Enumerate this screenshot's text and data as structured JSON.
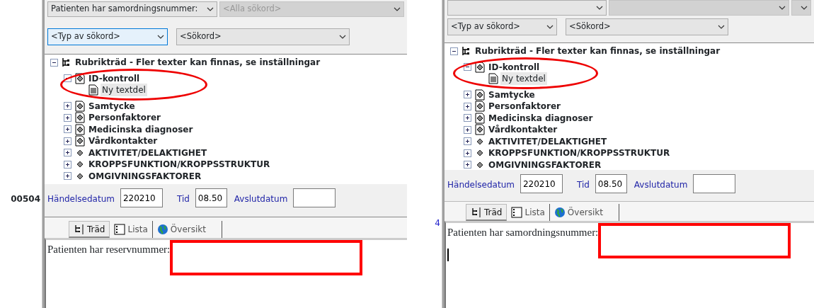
{
  "panels": [
    {
      "side_text": "00504",
      "top_combos": [
        {
          "text": "Patienten har samordningsnummer:",
          "disabled": false
        },
        {
          "text": "<Alla sökord>",
          "disabled": true
        }
      ],
      "search_type": {
        "text": "<Typ av sökord>",
        "focused": true
      },
      "keyword": {
        "text": "<Sökord>"
      },
      "tree": {
        "highlight_ellipse": true,
        "root": {
          "label": "Rubrikträd - Fler texter kan finnas, se inställningar",
          "kind": "root",
          "expanded": true,
          "children": [
            {
              "label": "ID-kontroll",
              "kind": "group",
              "expanded": true,
              "children": [
                {
                  "label": "Ny textdel",
                  "kind": "text",
                  "selected": true
                }
              ]
            },
            {
              "label": "Samtycke",
              "kind": "group",
              "expanded": false
            },
            {
              "label": "Personfaktorer",
              "kind": "group",
              "expanded": false
            },
            {
              "label": "Medicinska diagnoser",
              "kind": "group",
              "expanded": false
            },
            {
              "label": "Vårdkontakter",
              "kind": "group",
              "expanded": false
            },
            {
              "label": "AKTIVITET/DELAKTIGHET",
              "kind": "category",
              "expanded": false
            },
            {
              "label": "KROPPSFUNKTION/KROPPSSTRUKTUR",
              "kind": "category",
              "expanded": false
            },
            {
              "label": "OMGIVNINGSFAKTORER",
              "kind": "category",
              "expanded": false
            }
          ]
        }
      },
      "fields": [
        {
          "label": "Händelsedatum",
          "value": "220210"
        },
        {
          "label": "Tid",
          "value": "08.50"
        },
        {
          "label": "Avslutdatum"
        }
      ],
      "tabs": [
        {
          "label": "Träd",
          "selected": true
        },
        {
          "label": "Lista",
          "selected": false
        },
        {
          "label": "Översikt",
          "selected": false
        }
      ],
      "editor": {
        "text": "Patienten har reservnummer:",
        "highlight_box": true,
        "caret": false
      }
    },
    {
      "side_text": "4",
      "top_combos": [
        {
          "disabled": false
        },
        {
          "disabled": true
        },
        {
          "disabled": true
        }
      ],
      "search_type": {
        "text": "<Typ av sökord>",
        "focused": false
      },
      "keyword": {
        "text": "<Sökord>"
      },
      "tree": {
        "highlight_ellipse": true,
        "root": {
          "label": "Rubrikträd - Fler texter kan finnas, se inställningar",
          "kind": "root",
          "expanded": true,
          "children": [
            {
              "label": "ID-kontroll",
              "kind": "group",
              "expanded": true,
              "children": [
                {
                  "label": "Ny textdel",
                  "kind": "text",
                  "selected": true
                }
              ]
            },
            {
              "label": "Samtycke",
              "kind": "group",
              "expanded": false
            },
            {
              "label": "Personfaktorer",
              "kind": "group",
              "expanded": false
            },
            {
              "label": "Medicinska diagnoser",
              "kind": "group",
              "expanded": false
            },
            {
              "label": "Vårdkontakter",
              "kind": "group",
              "expanded": false
            },
            {
              "label": "AKTIVITET/DELAKTIGHET",
              "kind": "category",
              "expanded": false
            },
            {
              "label": "KROPPSFUNKTION/KROPPSSTRUKTUR",
              "kind": "category",
              "expanded": false
            },
            {
              "label": "OMGIVNINGSFAKTORER",
              "kind": "category",
              "expanded": false
            }
          ]
        }
      },
      "fields": [
        {
          "label": "Händelsedatum",
          "value": "220210"
        },
        {
          "label": "Tid",
          "value": "08.50"
        },
        {
          "label": "Avslutdatum"
        }
      ],
      "tabs": [
        {
          "label": "Träd",
          "selected": true
        },
        {
          "label": "Lista",
          "selected": false
        },
        {
          "label": "Översikt",
          "selected": false
        }
      ],
      "editor": {
        "text": "Patienten har samordningsnummer:",
        "highlight_box": true,
        "caret": true
      }
    }
  ]
}
